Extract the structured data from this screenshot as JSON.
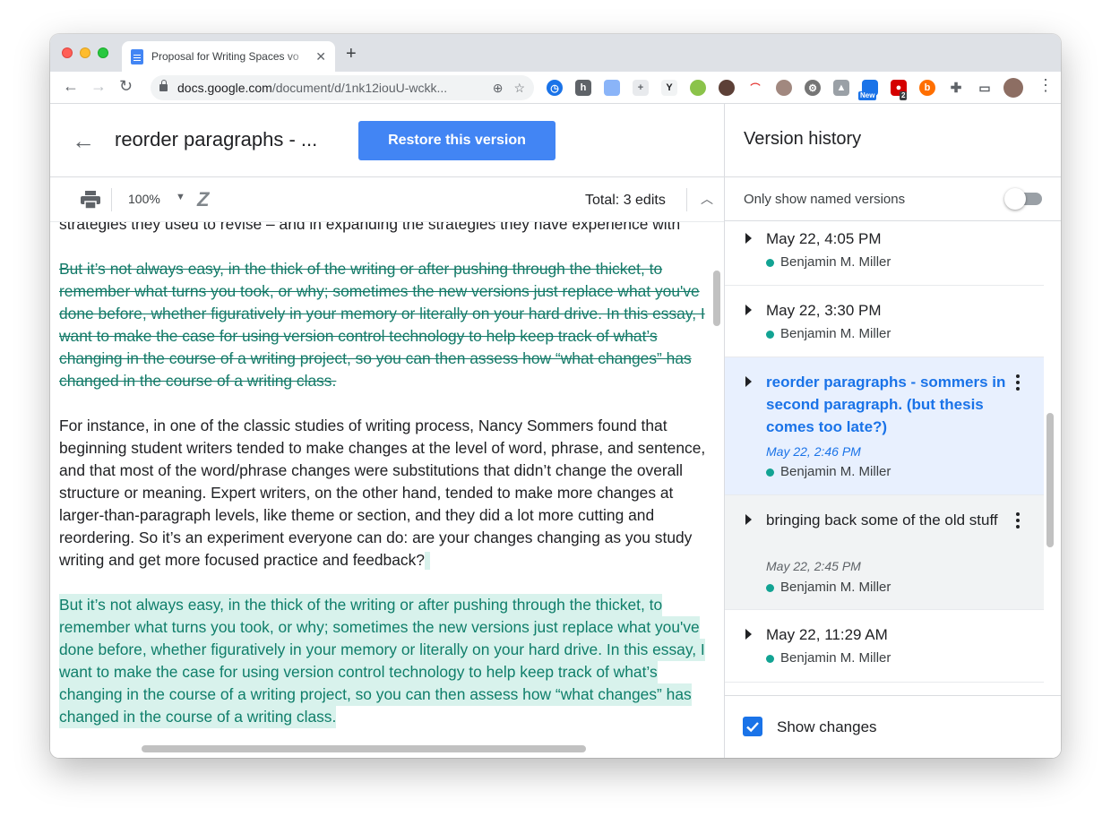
{
  "browser": {
    "tab_title": "Proposal for Writing Spaces vo",
    "url_host": "docs.google.com",
    "url_path": "/document/d/1nk12iouU-wckk...",
    "ext_new_badge": "New",
    "ext_count_badge": "2"
  },
  "doc": {
    "title": "reorder paragraphs - ...",
    "restore_label": "Restore this version",
    "zoom": "100%",
    "edits": "Total: 3 edits",
    "body": {
      "cut_line": "strategies they used to revise – and in expanding the strategies they have experience with",
      "deleted_lines": [
        "But it’s not always easy, in the thick of the writing or after pushing through the thicket, to",
        "remember what turns you took, or why; sometimes the new versions just replace what you've",
        "done before, whether figuratively in your memory or literally on your hard drive. In this essay, I",
        "want to make the case for using version control technology to help keep track of what’s",
        "changing in the course of a writing project, so you can then assess how “what changes” has",
        "changed in the course of a writing class."
      ],
      "para_lines": [
        "For instance, in one of the classic studies of writing process, Nancy Sommers found that",
        "beginning student writers tended to make changes at the level of word, phrase, and sentence,",
        "and that most of the word/phrase changes were substitutions that didn’t change the overall",
        "structure or meaning. Expert writers, on the other hand, tended to make more changes at",
        "larger-than-paragraph levels, like theme or section, and they did a lot more cutting and",
        "reordering. So it’s an experiment everyone can do: are your changes changing as you study",
        "writing and get more focused practice and feedback?"
      ],
      "inserted_lines": [
        "But it’s not always easy, in the thick of the writing or after pushing through the thicket, to",
        "remember what turns you took, or why; sometimes the new versions just replace what you've",
        "done before, whether figuratively in your memory or literally on your hard drive. In this essay, I",
        "want to make the case for using version control technology to help keep track of what’s",
        "changing in the course of a writing project, so you can then assess how “what changes” has",
        "changed in the course of a writing class."
      ]
    }
  },
  "panel": {
    "title": "Version history",
    "named_only_label": "Only show named versions",
    "named_only_on": false,
    "show_changes_label": "Show changes",
    "show_changes_checked": true,
    "versions": [
      {
        "title": "May 22, 4:05 PM",
        "author": "Benjamin M. Miller"
      },
      {
        "title": "May 22, 3:30 PM",
        "author": "Benjamin M. Miller"
      },
      {
        "title": "reorder paragraphs - sommers in second paragraph. (but thesis comes too late?)",
        "date": "May 22, 2:46 PM",
        "author": "Benjamin M. Miller"
      },
      {
        "title": "bringing back some of the old stuff",
        "date": "May 22, 2:45 PM",
        "author": "Benjamin M. Miller"
      },
      {
        "title": "May 22, 11:29 AM",
        "author": "Benjamin M. Miller"
      }
    ]
  },
  "colors": {
    "accent": "#4285f4",
    "selected_text": "#1a73e8",
    "deleted_text": "#137a68",
    "inserted_bg": "#d8f2ec",
    "author_dot": "#12a393"
  }
}
